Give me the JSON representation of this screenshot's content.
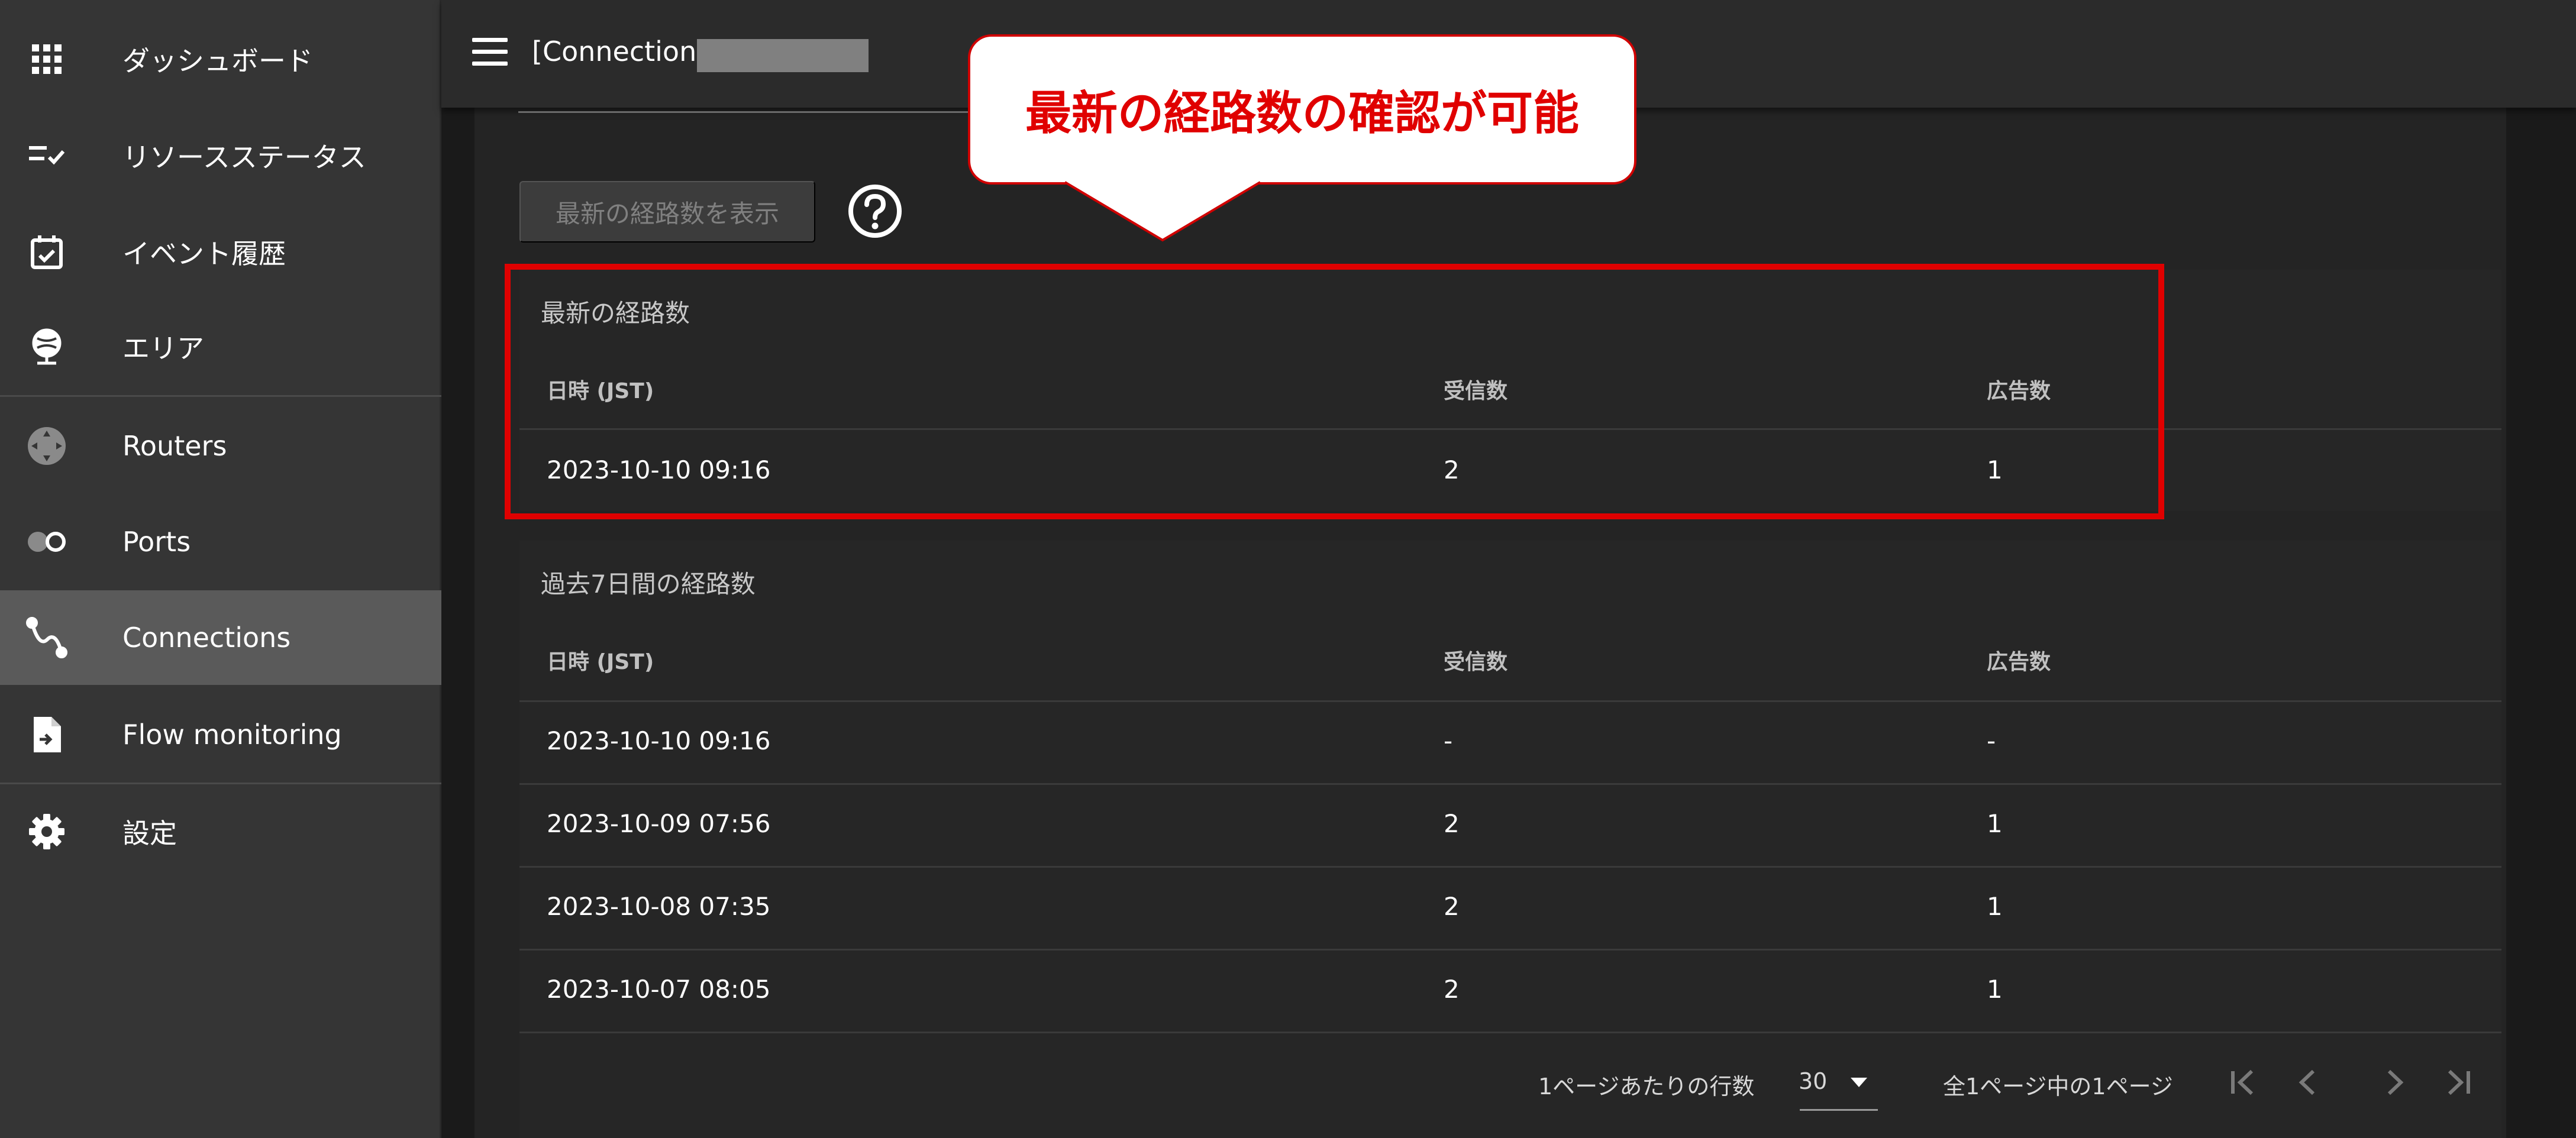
{
  "sidebar": {
    "items": [
      {
        "label": "ダッシュボード",
        "icon": "grid-icon"
      },
      {
        "label": "リソースステータス",
        "icon": "checklist-icon"
      },
      {
        "label": "イベント履歴",
        "icon": "calendar-check-icon"
      },
      {
        "label": "エリア",
        "icon": "globe-icon"
      },
      {
        "label": "Routers",
        "icon": "router-icon"
      },
      {
        "label": "Ports",
        "icon": "ports-icon"
      },
      {
        "label": "Connections",
        "icon": "connection-icon",
        "active": true
      },
      {
        "label": "Flow monitoring",
        "icon": "file-export-icon"
      },
      {
        "label": "設定",
        "icon": "gear-icon"
      }
    ]
  },
  "header": {
    "title": "[Connection] 1"
  },
  "actions": {
    "show_latest_label": "最新の経路数を表示"
  },
  "latest": {
    "title": "最新の経路数",
    "columns": [
      "日時 (JST)",
      "受信数",
      "広告数"
    ],
    "rows": [
      [
        "2023-10-10 09:16",
        "2",
        "1"
      ]
    ]
  },
  "past7": {
    "title": "過去7日間の経路数",
    "columns": [
      "日時 (JST)",
      "受信数",
      "広告数"
    ],
    "rows": [
      [
        "2023-10-10 09:16",
        "-",
        "-"
      ],
      [
        "2023-10-09 07:56",
        "2",
        "1"
      ],
      [
        "2023-10-08 07:35",
        "2",
        "1"
      ],
      [
        "2023-10-07 08:05",
        "2",
        "1"
      ]
    ]
  },
  "pagination": {
    "rows_per_page_label": "1ページあたりの行数",
    "rows_per_page_value": "30",
    "page_info": "全1ページ中の1ページ"
  },
  "annotation": {
    "callout_text": "最新の経路数の確認が可能"
  },
  "colors": {
    "highlight": "#e00000",
    "active_nav": "#5a5a5a"
  }
}
